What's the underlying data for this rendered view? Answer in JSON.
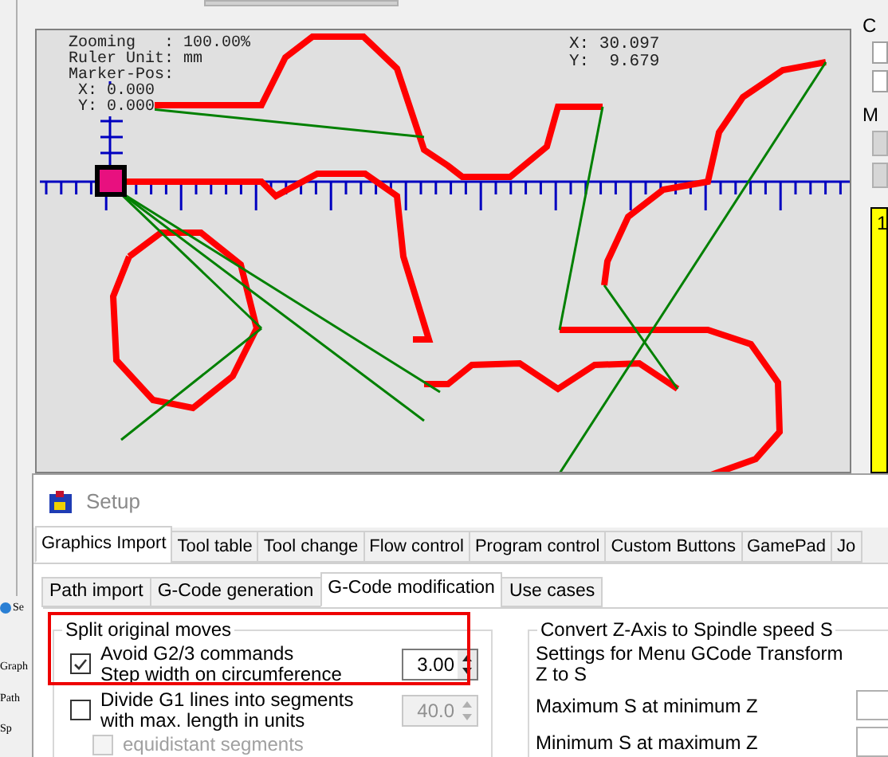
{
  "canvas": {
    "info_lines": [
      "Zooming   : 100.00%",
      "Ruler Unit: mm",
      "Marker-Pos:"
    ],
    "marker_x": "X: 0.000",
    "marker_y": "Y: 0.000",
    "cursor_x": "X: 30.097",
    "cursor_y": "Y:  9.679"
  },
  "side_panel": {
    "group_1_label": "C",
    "group_2_label": "M",
    "code_text": "1"
  },
  "background_window": {
    "texts": [
      "Se",
      "Graph",
      "Path",
      "Sp"
    ]
  },
  "dialog": {
    "title": "Setup",
    "tabs": [
      {
        "label": "Graphics Import",
        "selected": true
      },
      {
        "label": "Tool table",
        "selected": false
      },
      {
        "label": "Tool change",
        "selected": false
      },
      {
        "label": "Flow control",
        "selected": false
      },
      {
        "label": "Program control",
        "selected": false
      },
      {
        "label": "Custom Buttons",
        "selected": false
      },
      {
        "label": "GamePad",
        "selected": false
      },
      {
        "label": "Jo",
        "selected": false
      }
    ],
    "sub_tabs": [
      {
        "label": "Path import",
        "selected": false
      },
      {
        "label": "G-Code generation",
        "selected": false
      },
      {
        "label": "G-Code modification",
        "selected": true
      },
      {
        "label": "Use cases",
        "selected": false
      }
    ],
    "split_group": {
      "title": "Split original moves",
      "highlighted": true,
      "options": [
        {
          "kind": "spin",
          "lines": [
            "Avoid G2/3 commands",
            "Step width on circumference"
          ],
          "checked": true,
          "value": "3.00",
          "disabled": false
        },
        {
          "kind": "spin",
          "lines": [
            "Divide G1 lines into segments",
            "with max. length in units"
          ],
          "checked": false,
          "value": "40.0",
          "disabled": true
        },
        {
          "kind": "check",
          "lines": [
            "equidistant segments"
          ],
          "checked": false,
          "disabled": true
        }
      ]
    },
    "z_group": {
      "title": "Convert Z-Axis to Spindle speed S",
      "description": [
        "Settings for Menu GCode Transform",
        "Z to S"
      ],
      "fields": [
        {
          "label": "Maximum S at minimum Z"
        },
        {
          "label": "Minimum S at maximum Z"
        }
      ]
    }
  }
}
